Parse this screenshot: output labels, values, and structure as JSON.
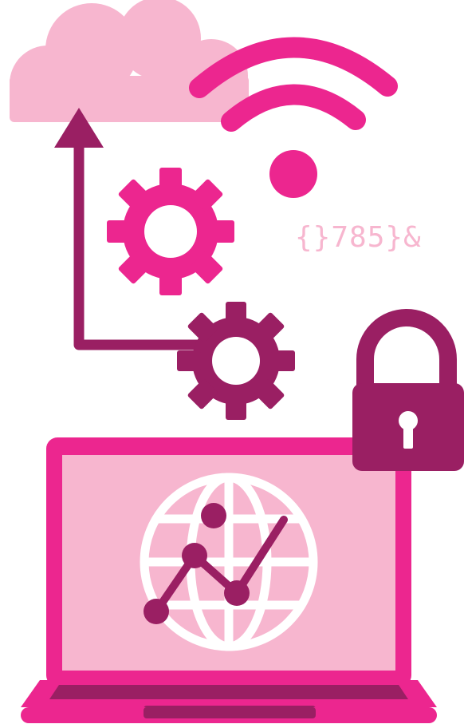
{
  "illustration": {
    "code_snippet": "{}785}&",
    "icons": [
      "cloud-icon",
      "wifi-icon",
      "upload-arrow-icon",
      "gear-icon",
      "gear-icon",
      "padlock-icon",
      "laptop-icon",
      "globe-icon",
      "line-chart-icon"
    ]
  },
  "colors": {
    "light_pink": "#f7b6cf",
    "magenta": "#ec268f",
    "plum": "#9a1f63",
    "white": "#ffffff"
  }
}
